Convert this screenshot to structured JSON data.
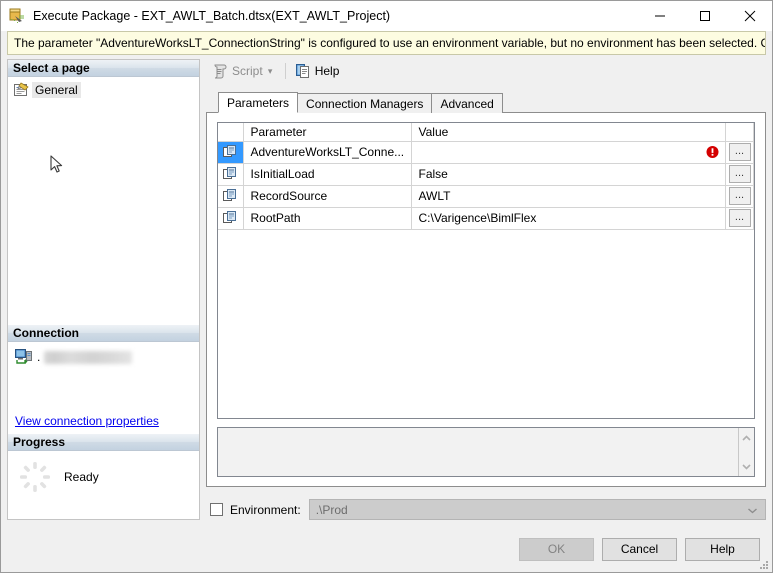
{
  "window": {
    "title": "Execute Package - EXT_AWLT_Batch.dtsx(EXT_AWLT_Project)",
    "icon": "execute-package-icon",
    "minimize_label": "Minimize",
    "maximize_label": "Maximize",
    "close_label": "Close"
  },
  "warning": {
    "text": "The parameter \"AdventureWorksLT_ConnectionString\" is configured to use an environment variable, but no environment has been selected.  Check the \"Envir...",
    "background": "#fdfce1",
    "border": "#c8c8a8"
  },
  "left_pane": {
    "select_page": {
      "header": "Select a page",
      "items": [
        {
          "label": "General",
          "icon": "page-general-icon",
          "selected": true
        }
      ]
    },
    "connection": {
      "header": "Connection",
      "icon": "server-connection-icon",
      "separator": ".",
      "server_name": "",
      "link_label": "View connection properties"
    },
    "progress": {
      "header": "Progress",
      "icon": "progress-spinner-icon",
      "status": "Ready"
    }
  },
  "toolbar": {
    "script_label": "Script",
    "script_icon": "script-icon",
    "script_caret": "▾",
    "script_disabled": true,
    "help_label": "Help",
    "help_icon": "help-page-icon"
  },
  "tabs": [
    {
      "label": "Parameters",
      "active": true
    },
    {
      "label": "Connection Managers",
      "active": false
    },
    {
      "label": "Advanced",
      "active": false
    }
  ],
  "grid": {
    "columns": [
      "",
      "Parameter",
      "Value",
      ""
    ],
    "row_icon": "parameter-icon",
    "dots_label": "...",
    "error_icon": "error-icon",
    "rows": [
      {
        "parameter": "AdventureWorksLT_Conne...",
        "value": "",
        "error": true,
        "selected": true
      },
      {
        "parameter": "IsInitialLoad",
        "value": "False",
        "error": false,
        "selected": false
      },
      {
        "parameter": "RecordSource",
        "value": "AWLT",
        "error": false,
        "selected": false
      },
      {
        "parameter": "RootPath",
        "value": "C:\\Varigence\\BimlFlex",
        "error": false,
        "selected": false
      }
    ]
  },
  "description_box": {
    "text": "",
    "scroll_up_icon": "chevron-up-icon",
    "scroll_down_icon": "chevron-down-icon"
  },
  "environment": {
    "checkbox_checked": false,
    "label": "Environment:",
    "value": ".\\Prod",
    "enabled": false,
    "caret_icon": "chevron-down-icon"
  },
  "footer": {
    "ok_label": "OK",
    "ok_disabled": true,
    "cancel_label": "Cancel",
    "help_label": "Help",
    "grip_icon": "resize-grip-icon"
  },
  "colors": {
    "accent_selection": "#3399ff",
    "error_red": "#d40000",
    "link_blue": "#0000ee",
    "dialog_bg": "#f0f0f0"
  }
}
